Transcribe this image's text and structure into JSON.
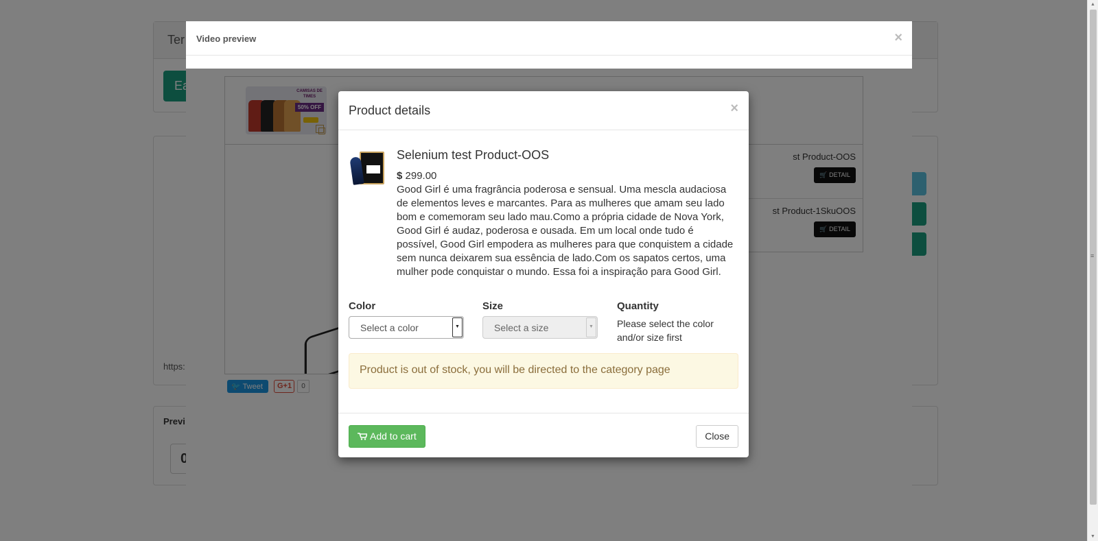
{
  "background_page": {
    "panel_title_partial": "Ter",
    "button_partial": "Ea",
    "url_partial": "https:",
    "preview_label_partial": "Previ",
    "counter_partial": "0"
  },
  "video_preview_modal": {
    "title": "Video preview",
    "close_symbol": "×",
    "banner_text": "CAMISAS DE TIMES",
    "banner_subtext": "LOJA 20%",
    "banner_off": "50% OFF",
    "list_items": [
      {
        "name": "st Product-OOS",
        "detail_label": "DETAIL"
      },
      {
        "name": "st Product-1SkuOOS",
        "detail_label": "DETAIL"
      }
    ],
    "social": {
      "tweet_label": "Tweet",
      "gplus_label": "G+1",
      "gplus_count": "0"
    }
  },
  "product_modal": {
    "title": "Product details",
    "close_symbol": "×",
    "product": {
      "name": "Selenium test Product-OOS",
      "currency": "$",
      "price": "299.00",
      "description": "Good Girl é uma fragrância poderosa e sensual. Uma mescla audaciosa de elementos leves e marcantes. Para as mulheres que amam seu lado bom e comemoram seu lado mau.Como a própria cidade de Nova York, Good Girl é audaz, poderosa e ousada. Em um local onde tudo é possível, Good Girl empodera as mulheres para que conquistem a cidade sem nunca deixarem sua essência de lado.Com os sapatos certos, uma mulher pode conquistar o mundo. Essa foi a inspiração para Good Girl."
    },
    "fields": {
      "color_label": "Color",
      "color_placeholder": "Select a color",
      "size_label": "Size",
      "size_placeholder": "Select a size",
      "quantity_label": "Quantity",
      "quantity_note": "Please select the color and/or size first"
    },
    "alert": "Product is out of stock, you will be directed to the category page",
    "footer": {
      "add_to_cart_label": "Add to cart",
      "close_label": "Close"
    }
  },
  "colors": {
    "success": "#5cb85c",
    "warning_bg": "#fcf8e3",
    "warning_text": "#8a6d3b",
    "tweet_blue": "#1b95e0",
    "brand_orange": "#e94e1b"
  }
}
